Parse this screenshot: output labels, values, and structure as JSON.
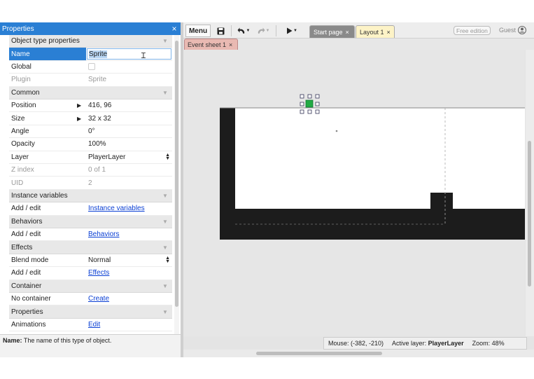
{
  "properties": {
    "title": "Properties",
    "close": "×",
    "rows": [
      {
        "name": "Object type properties",
        "type": "section"
      },
      {
        "name": "Name",
        "value": "Sprite",
        "type": "input"
      },
      {
        "name": "Global",
        "type": "checkbox"
      },
      {
        "name": "Plugin",
        "value": "Sprite",
        "type": "disabled"
      },
      {
        "name": "Common",
        "type": "section"
      },
      {
        "name": "Position",
        "value": "416, 96",
        "type": "expand"
      },
      {
        "name": "Size",
        "value": "32 x 32",
        "type": "expand"
      },
      {
        "name": "Angle",
        "value": "0°",
        "type": "text"
      },
      {
        "name": "Opacity",
        "value": "100%",
        "type": "text"
      },
      {
        "name": "Layer",
        "value": "PlayerLayer",
        "type": "select"
      },
      {
        "name": "Z index",
        "value": "0 of 1",
        "type": "disabled"
      },
      {
        "name": "UID",
        "value": "2",
        "type": "disabled"
      },
      {
        "name": "Instance variables",
        "type": "section"
      },
      {
        "name": "Add / edit",
        "value": "Instance variables",
        "type": "link"
      },
      {
        "name": "Behaviors",
        "type": "section"
      },
      {
        "name": "Add / edit",
        "value": "Behaviors",
        "type": "link"
      },
      {
        "name": "Effects",
        "type": "section"
      },
      {
        "name": "Blend mode",
        "value": "Normal",
        "type": "select"
      },
      {
        "name": "Add / edit",
        "value": "Effects",
        "type": "link"
      },
      {
        "name": "Container",
        "type": "section"
      },
      {
        "name": "No container",
        "value": "Create",
        "type": "link"
      },
      {
        "name": "Properties",
        "type": "section"
      },
      {
        "name": "Animations",
        "value": "Edit",
        "type": "link"
      }
    ],
    "footer_label": "Name:",
    "footer_text": "The name of this type of object."
  },
  "toolbar": {
    "menu_label": "Menu",
    "icons": [
      "save-icon",
      "undo-icon",
      "redo-icon",
      "play-icon"
    ],
    "tabs": [
      {
        "label": "Start page",
        "close": "×"
      },
      {
        "label": "Layout 1",
        "close": "×"
      }
    ],
    "edition_label": "Free edition",
    "user_label": "Guest"
  },
  "subtabs": {
    "event_sheet": "Event sheet 1",
    "close": "×"
  },
  "status": {
    "mouse": "Mouse: (-382, -210)",
    "active_layer_label": "Active layer:",
    "active_layer_value": "PlayerLayer",
    "zoom": "Zoom: 48%"
  },
  "colors": {
    "accent": "#2a7fd4",
    "layout_tab": "#fdf3c7",
    "event_tab": "#e9b9b2",
    "sprite": "#22aa44",
    "ground": "#1c1c1c"
  }
}
